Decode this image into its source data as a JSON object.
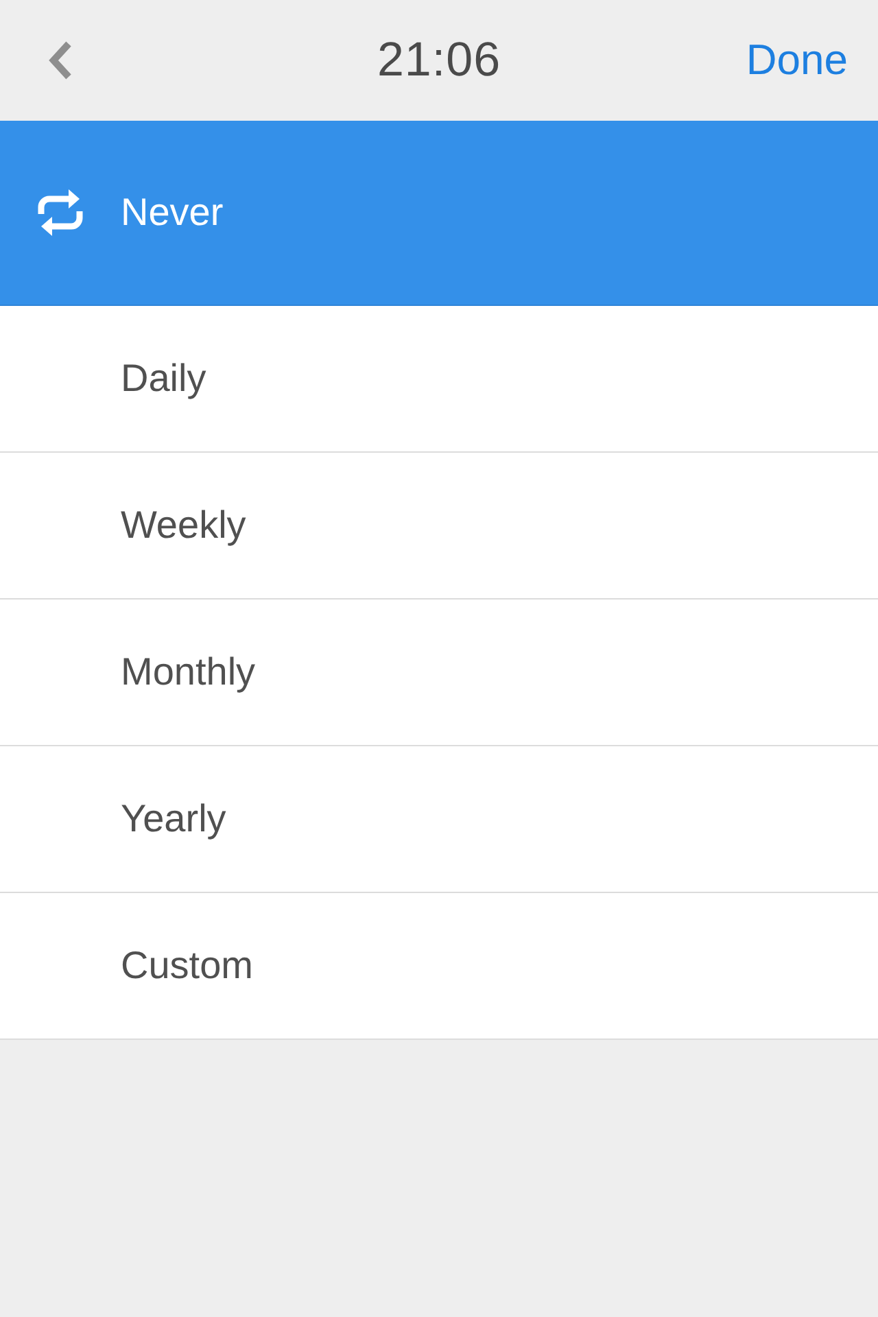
{
  "header": {
    "title": "21:06",
    "done": "Done"
  },
  "options": [
    {
      "label": "Never",
      "selected": true
    },
    {
      "label": "Daily",
      "selected": false
    },
    {
      "label": "Weekly",
      "selected": false
    },
    {
      "label": "Monthly",
      "selected": false
    },
    {
      "label": "Yearly",
      "selected": false
    },
    {
      "label": "Custom",
      "selected": false
    }
  ]
}
